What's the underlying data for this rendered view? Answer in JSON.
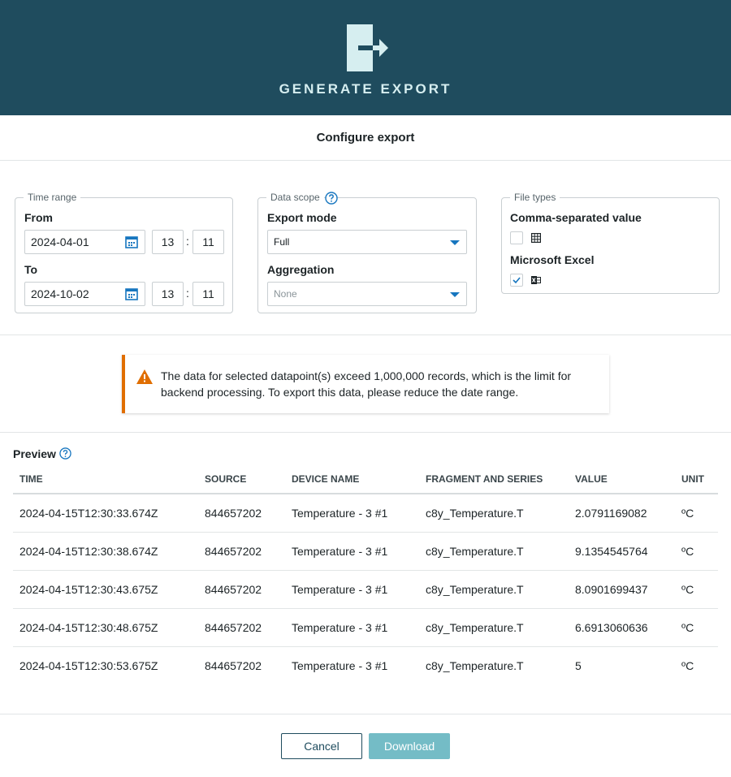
{
  "header": {
    "title": "GENERATE EXPORT",
    "logo_icon": "export-arrow-icon"
  },
  "subheader": {
    "title": "Configure export"
  },
  "time_range": {
    "legend": "Time range",
    "from_label": "From",
    "from_date": "2024-04-01",
    "from_hour": "13",
    "from_minute": "11",
    "to_label": "To",
    "to_date": "2024-10-02",
    "to_hour": "13",
    "to_minute": "11",
    "separator": ":"
  },
  "data_scope": {
    "legend": "Data scope",
    "export_mode_label": "Export mode",
    "export_mode_value": "Full",
    "aggregation_label": "Aggregation",
    "aggregation_value": "None"
  },
  "file_types": {
    "legend": "File types",
    "csv_label": "Comma-separated value",
    "csv_checked": false,
    "excel_label": "Microsoft Excel",
    "excel_checked": true
  },
  "alert": {
    "type": "warning",
    "message": "The data for selected datapoint(s) exceed 1,000,000 records, which is the limit for backend processing. To export this data, please reduce the date range."
  },
  "preview": {
    "label": "Preview",
    "columns": [
      "TIME",
      "SOURCE",
      "DEVICE NAME",
      "FRAGMENT AND SERIES",
      "VALUE",
      "UNIT"
    ],
    "rows": [
      [
        "2024-04-15T12:30:33.674Z",
        "844657202",
        "Temperature - 3 #1",
        "c8y_Temperature.T",
        "2.0791169082",
        "ºC"
      ],
      [
        "2024-04-15T12:30:38.674Z",
        "844657202",
        "Temperature - 3 #1",
        "c8y_Temperature.T",
        "9.1354545764",
        "ºC"
      ],
      [
        "2024-04-15T12:30:43.675Z",
        "844657202",
        "Temperature - 3 #1",
        "c8y_Temperature.T",
        "8.0901699437",
        "ºC"
      ],
      [
        "2024-04-15T12:30:48.675Z",
        "844657202",
        "Temperature - 3 #1",
        "c8y_Temperature.T",
        "6.6913060636",
        "ºC"
      ],
      [
        "2024-04-15T12:30:53.675Z",
        "844657202",
        "Temperature - 3 #1",
        "c8y_Temperature.T",
        "5",
        "ºC"
      ]
    ]
  },
  "footer": {
    "cancel_label": "Cancel",
    "download_label": "Download"
  },
  "colors": {
    "header_bg": "#1f4c5e",
    "accent": "#1776bf",
    "warning": "#e06e00",
    "download_bg": "#74bcc6"
  }
}
